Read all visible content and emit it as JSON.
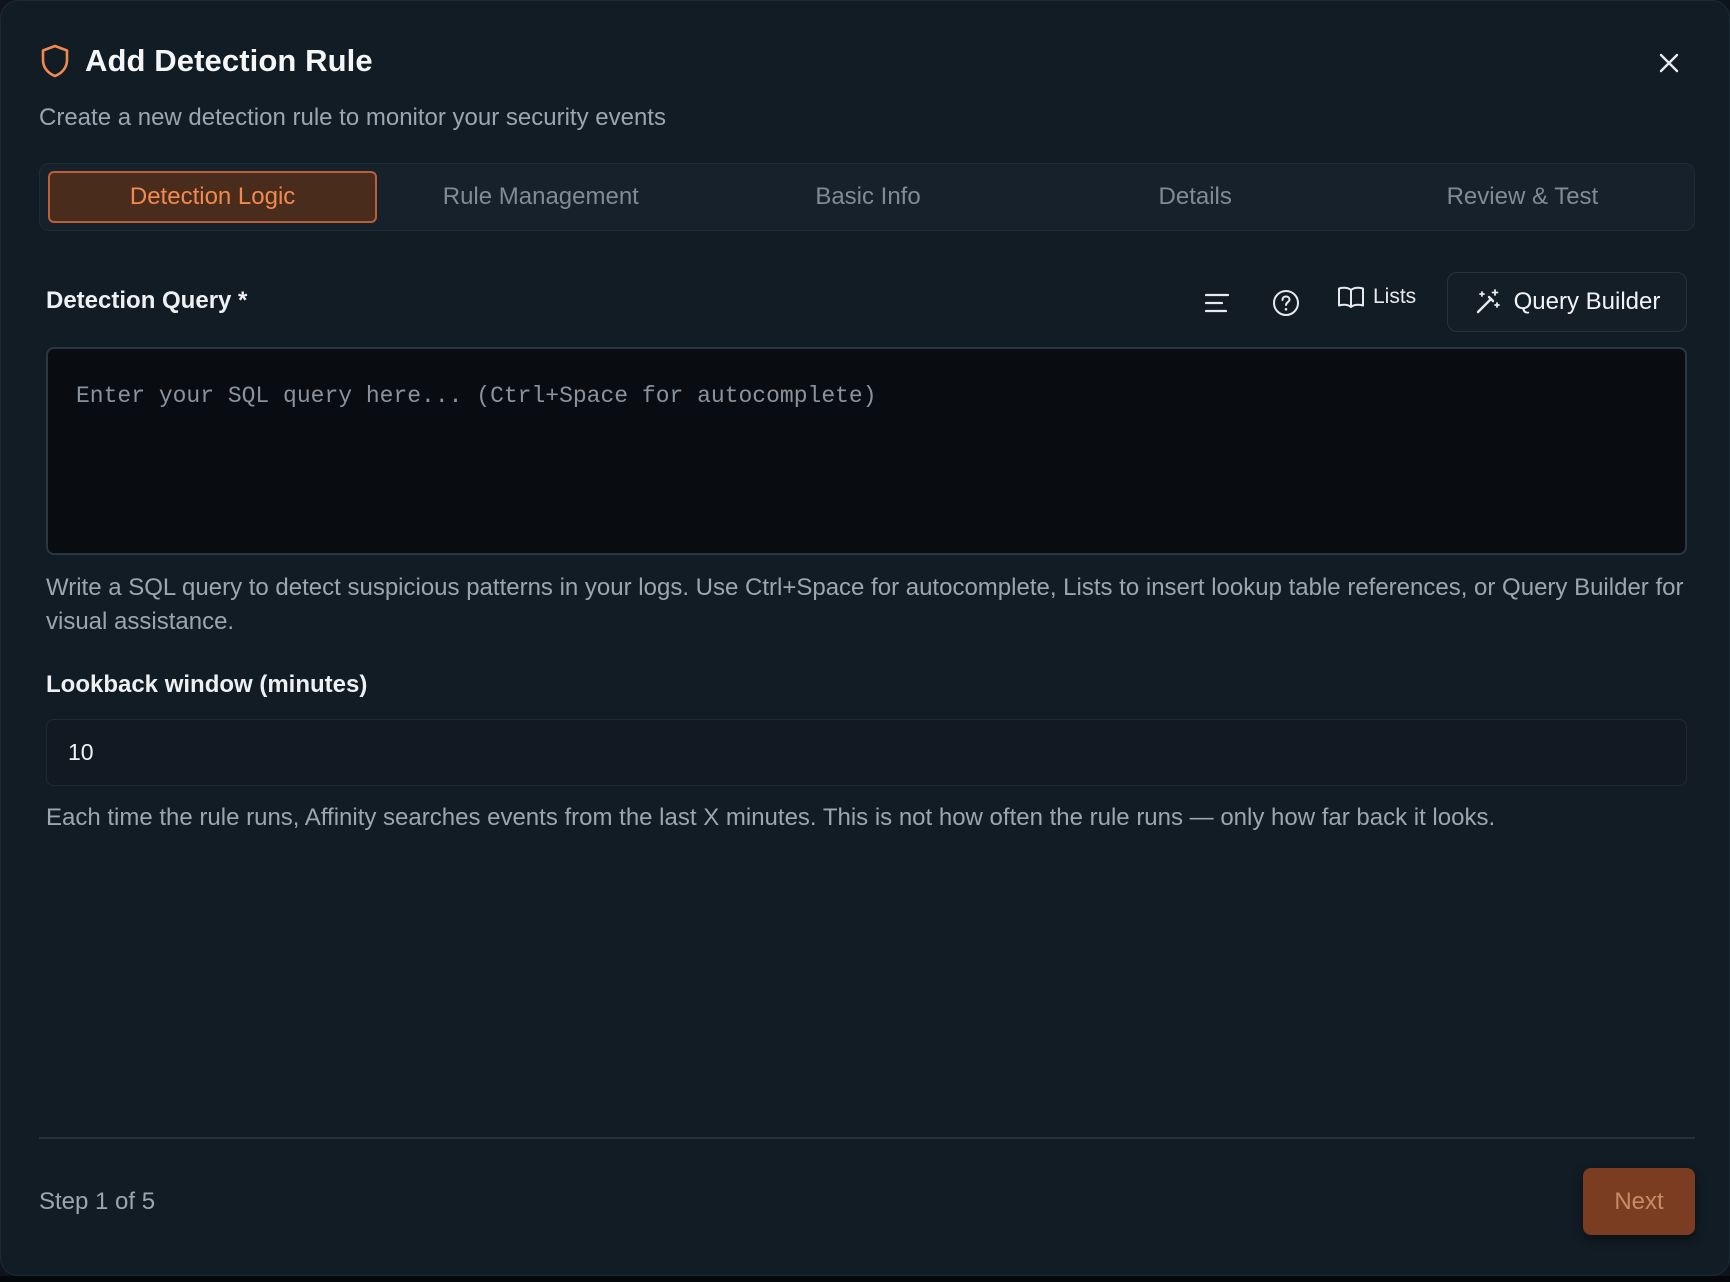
{
  "dialog": {
    "title": "Add Detection Rule",
    "subtitle": "Create a new detection rule to monitor your security events",
    "icon": "shield-icon",
    "accent_color": "#f08a4e"
  },
  "tabs": [
    {
      "label": "Detection Logic",
      "active": true
    },
    {
      "label": "Rule Management",
      "active": false
    },
    {
      "label": "Basic Info",
      "active": false
    },
    {
      "label": "Details",
      "active": false
    },
    {
      "label": "Review & Test",
      "active": false
    }
  ],
  "query": {
    "label": "Detection Query *",
    "placeholder": "Enter your SQL query here... (Ctrl+Space for autocomplete)",
    "value": "",
    "help": "Write a SQL query to detect suspicious patterns in your logs. Use Ctrl+Space for autocomplete, Lists to insert lookup table references, or Query Builder for visual assistance.",
    "toolbar": {
      "format_icon": "align-left-icon",
      "help_icon": "help-circle-icon",
      "lists_label": "Lists",
      "lists_icon": "book-open-icon",
      "query_builder_label": "Query Builder",
      "query_builder_icon": "magic-wand-icon"
    }
  },
  "lookback": {
    "label": "Lookback window (minutes)",
    "value": "10",
    "help": "Each time the rule runs, Affinity searches events from the last X minutes. This is not how often the rule runs — only how far back it looks."
  },
  "footer": {
    "step_text": "Step 1 of 5",
    "next_label": "Next"
  }
}
